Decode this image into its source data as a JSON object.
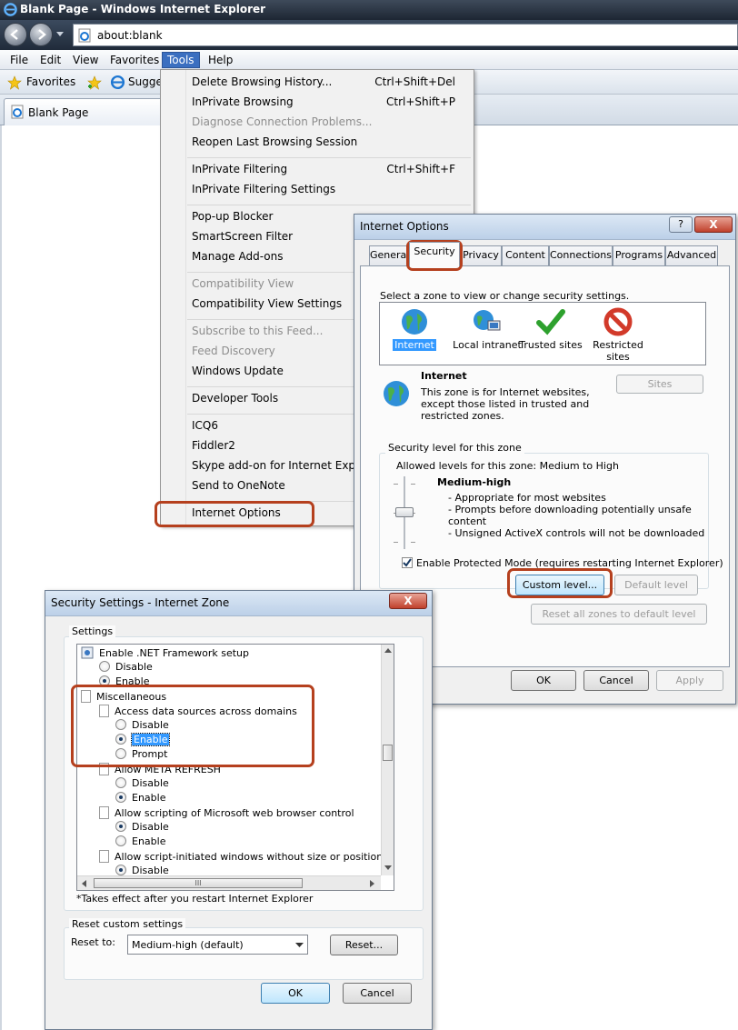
{
  "browser": {
    "window_title": "Blank Page - Windows Internet Explorer",
    "address": "about:blank",
    "menus": [
      "File",
      "Edit",
      "View",
      "Favorites",
      "Tools",
      "Help"
    ],
    "favorites_label": "Favorites",
    "suggested_label": "Sugges",
    "tab_label": "Blank Page"
  },
  "tools_menu": {
    "items": [
      {
        "label": "Delete Browsing History...",
        "shortcut": "Ctrl+Shift+Del"
      },
      {
        "label": "InPrivate Browsing",
        "shortcut": "Ctrl+Shift+P"
      },
      {
        "label": "Diagnose Connection Problems..."
      },
      {
        "label": "Reopen Last Browsing Session"
      },
      {
        "label": "InPrivate Filtering",
        "shortcut": "Ctrl+Shift+F"
      },
      {
        "label": "InPrivate Filtering Settings"
      },
      {
        "label": "Pop-up Blocker"
      },
      {
        "label": "SmartScreen Filter"
      },
      {
        "label": "Manage Add-ons"
      },
      {
        "label": "Compatibility View"
      },
      {
        "label": "Compatibility View Settings"
      },
      {
        "label": "Subscribe to this Feed..."
      },
      {
        "label": "Feed Discovery"
      },
      {
        "label": "Windows Update"
      },
      {
        "label": "Developer Tools"
      },
      {
        "label": "ICQ6"
      },
      {
        "label": "Fiddler2"
      },
      {
        "label": "Skype add-on for Internet Explore"
      },
      {
        "label": "Send to OneNote"
      },
      {
        "label": "Internet Options"
      }
    ]
  },
  "internet_options": {
    "title": "Internet Options",
    "help": "?",
    "close": "X",
    "tabs": [
      "General",
      "Security",
      "Privacy",
      "Content",
      "Connections",
      "Programs",
      "Advanced"
    ],
    "zone_prompt": "Select a zone to view or change security settings.",
    "zones": [
      "Internet",
      "Local intranet",
      "Trusted sites",
      "Restricted sites"
    ],
    "zone_title": "Internet",
    "zone_desc": [
      "This zone is for Internet websites,",
      "except those listed in trusted and",
      "restricted zones."
    ],
    "sites_button": "Sites",
    "security_level_group": "Security level for this zone",
    "allowed_levels": "Allowed levels for this zone: Medium to High",
    "level_name": "Medium-high",
    "level_bullets": [
      "- Appropriate for most websites",
      "- Prompts before downloading potentially unsafe",
      "content",
      "- Unsigned ActiveX controls will not be downloaded"
    ],
    "protected_mode": "Enable Protected Mode (requires restarting Internet Explorer)",
    "custom_level": "Custom level...",
    "default_level": "Default level",
    "reset_all": "Reset all zones to default level",
    "ok": "OK",
    "cancel": "Cancel",
    "apply": "Apply"
  },
  "security_settings": {
    "title": "Security Settings - Internet Zone",
    "close": "X",
    "settings_group": "Settings",
    "tree": {
      "net_setup": "Enable .NET Framework setup",
      "opt_disable": "Disable",
      "opt_enable": "Enable",
      "opt_prompt": "Prompt",
      "misc": "Miscellaneous",
      "access_data": "Access data sources across domains",
      "meta_refresh": "Allow META REFRESH",
      "scripting_browser": "Allow scripting of Microsoft web browser control",
      "script_windows": "Allow script-initiated windows without size or position constra"
    },
    "scroll_mark": "III",
    "note": "*Takes effect after you restart Internet Explorer",
    "reset_group": "Reset custom settings",
    "reset_to_label": "Reset to:",
    "reset_to_value": "Medium-high (default)",
    "reset_button": "Reset...",
    "ok": "OK",
    "cancel": "Cancel"
  },
  "colors": {
    "highlight": "#b5401e",
    "selection": "#3399ff"
  }
}
